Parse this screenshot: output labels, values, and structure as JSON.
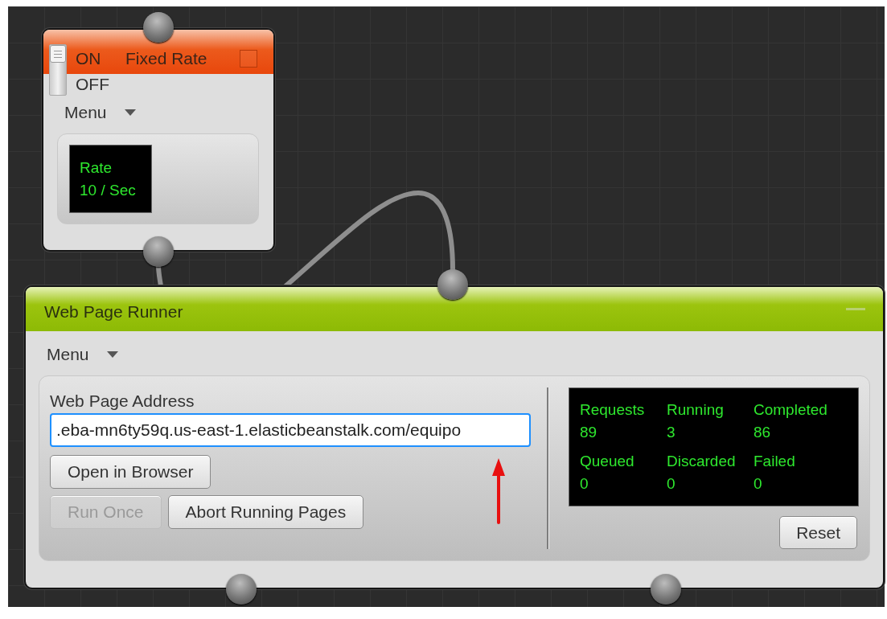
{
  "rate_node": {
    "toggle": {
      "on_label": "ON",
      "off_label": "OFF",
      "on": true
    },
    "fixed_rate": {
      "label": "Fixed Rate",
      "checked": false
    },
    "menu": "Menu",
    "display": [
      "Rate",
      "10 / Sec"
    ]
  },
  "runner_node": {
    "title": "Web Page Runner",
    "menu": "Menu",
    "address": {
      "label": "Web Page Address",
      "value": ".eba-mn6ty59q.us-east-1.elasticbeanstalk.com/equipo"
    },
    "buttons": [
      {
        "label": "Open in Browser",
        "disabled": false
      },
      {
        "label": "Run Once",
        "disabled": true
      },
      {
        "label": "Abort Running Pages",
        "disabled": false
      }
    ],
    "stats": [
      {
        "label": "Requests",
        "value": "89"
      },
      {
        "label": "Running",
        "value": "3"
      },
      {
        "label": "Completed",
        "value": "86"
      },
      {
        "label": "Queued",
        "value": "0"
      },
      {
        "label": "Discarded",
        "value": "0"
      },
      {
        "label": "Failed",
        "value": "0"
      }
    ],
    "reset": "Reset"
  }
}
